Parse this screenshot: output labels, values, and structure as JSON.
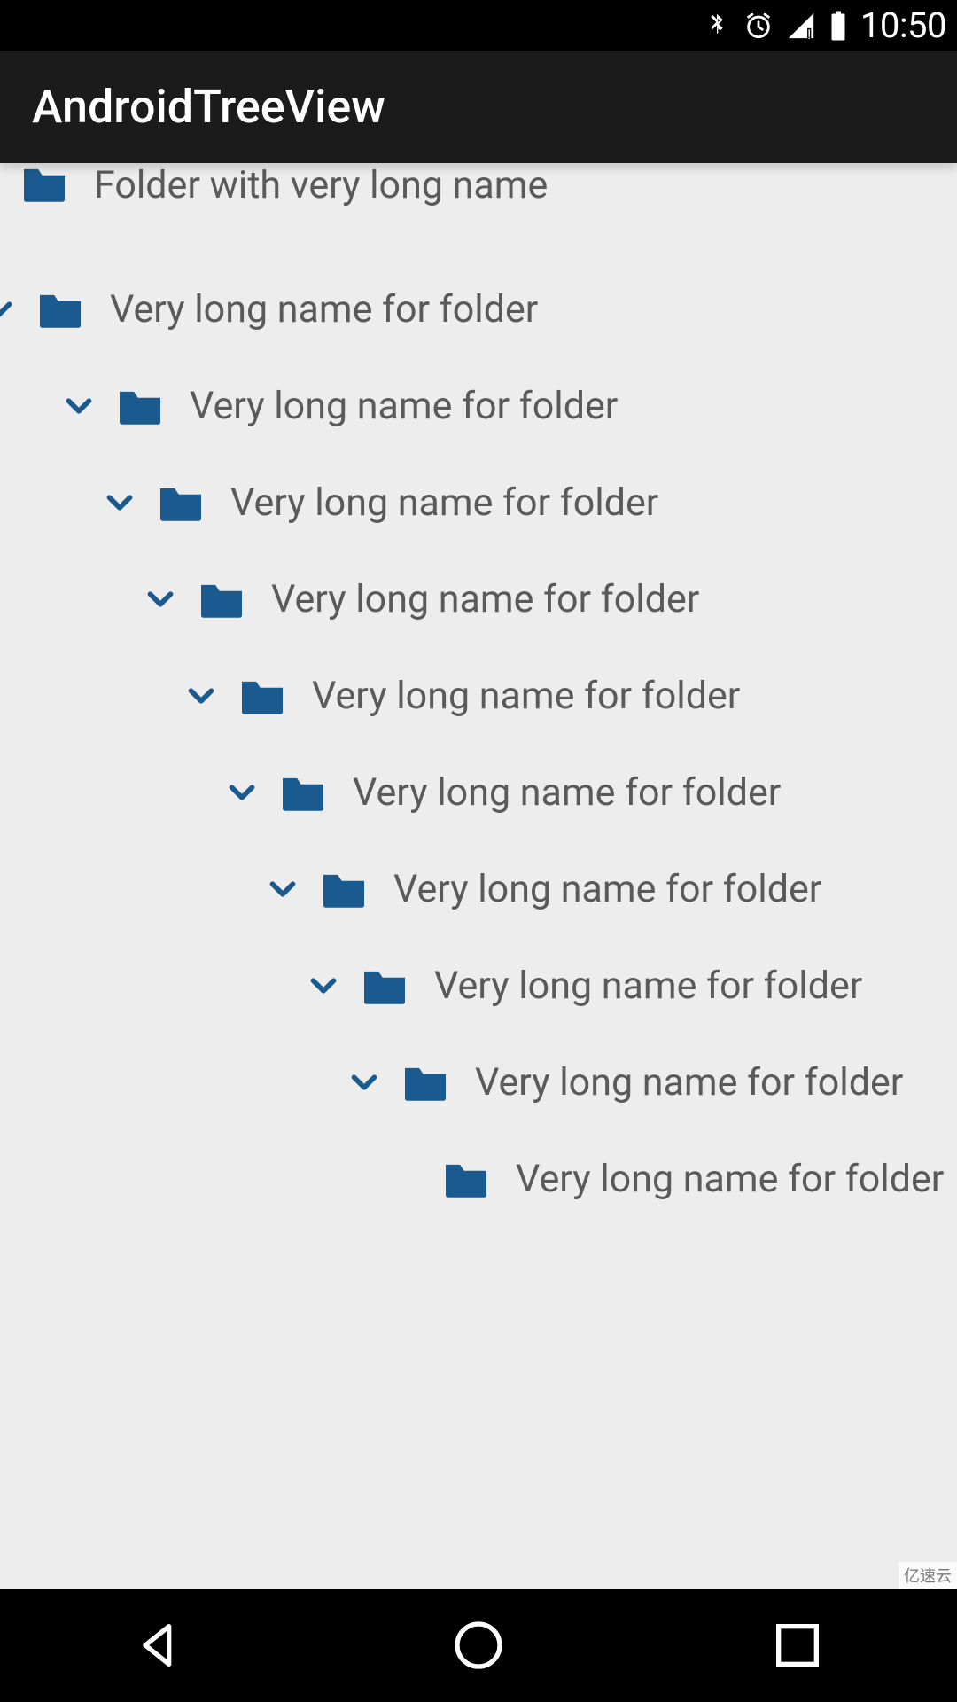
{
  "status": {
    "time": "10:50"
  },
  "header": {
    "title": "AndroidTreeView"
  },
  "tree": {
    "rows": [
      {
        "level": 0,
        "has_chevron": false,
        "label": "Folder with very long name",
        "first": true
      },
      {
        "level": 0,
        "has_chevron": true,
        "label": "Very long name for folder"
      },
      {
        "level": 1,
        "has_chevron": true,
        "label": "Very long name for folder"
      },
      {
        "level": 2,
        "has_chevron": true,
        "label": "Very long name for folder"
      },
      {
        "level": 3,
        "has_chevron": true,
        "label": "Very long name for folder"
      },
      {
        "level": 4,
        "has_chevron": true,
        "label": "Very long name for folder"
      },
      {
        "level": 5,
        "has_chevron": true,
        "label": "Very long name for folder"
      },
      {
        "level": 6,
        "has_chevron": true,
        "label": "Very long name for folder"
      },
      {
        "level": 7,
        "has_chevron": true,
        "label": "Very long name for folder"
      },
      {
        "level": 8,
        "has_chevron": true,
        "label": "Very long name for folder"
      },
      {
        "level": 9,
        "has_chevron": false,
        "label": "Very long name for folder"
      }
    ]
  },
  "colors": {
    "folder": "#1b5a8f",
    "chevron": "#1b5a8f",
    "text": "#5a5a5a",
    "bg": "#ededed"
  },
  "watermark": "亿速云"
}
